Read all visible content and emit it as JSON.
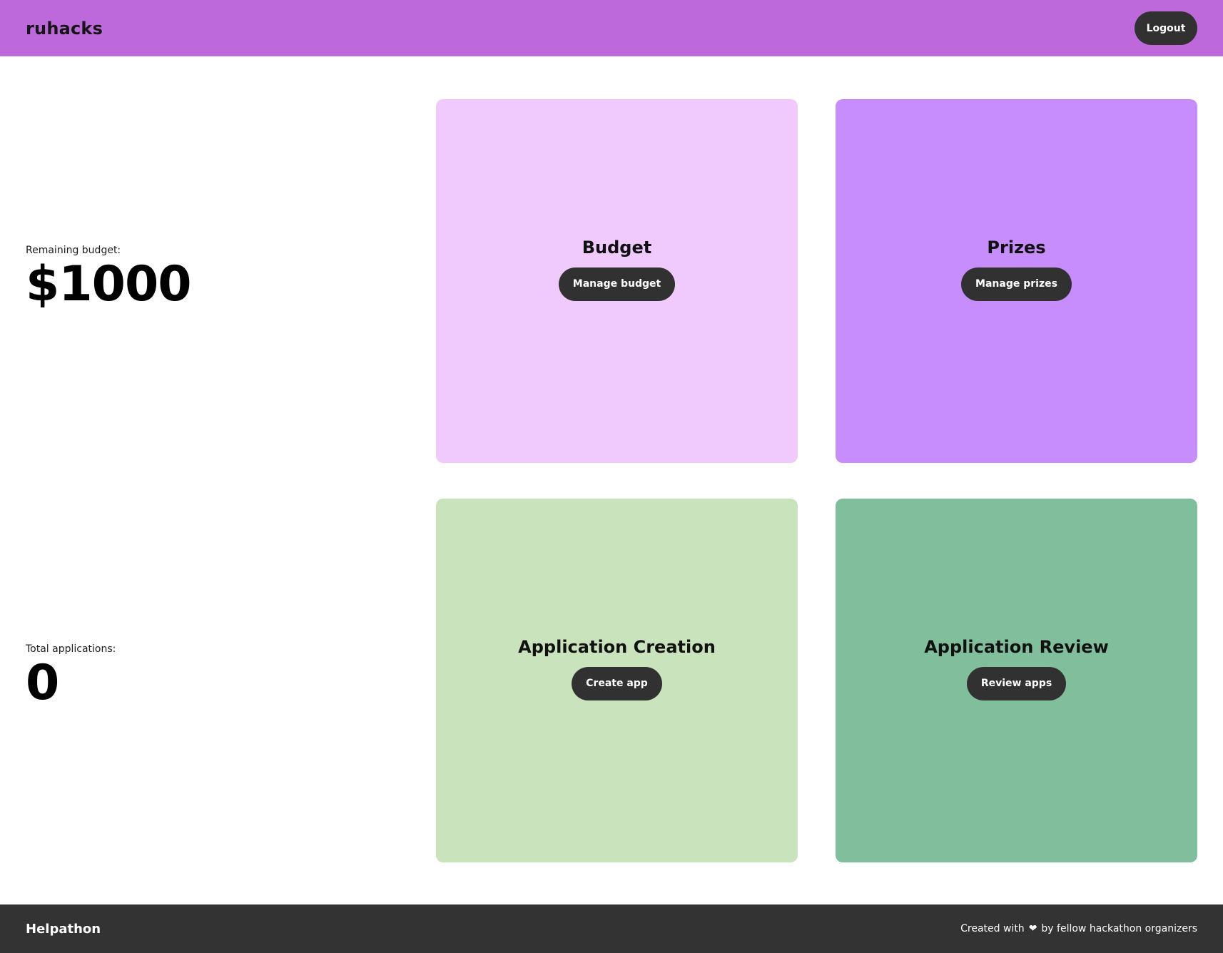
{
  "header": {
    "brand": "ruhacks",
    "logout_label": "Logout"
  },
  "stats": {
    "budget": {
      "label": "Remaining budget:",
      "value": "$1000"
    },
    "applications": {
      "label": "Total applications:",
      "value": "0"
    }
  },
  "cards": {
    "budget": {
      "title": "Budget",
      "button": "Manage budget"
    },
    "prizes": {
      "title": "Prizes",
      "button": "Manage prizes"
    },
    "create": {
      "title": "Application Creation",
      "button": "Create app"
    },
    "review": {
      "title": "Application Review",
      "button": "Review apps"
    }
  },
  "footer": {
    "brand": "Helpathon",
    "credit_before": "Created with",
    "heart_icon": "heart-icon",
    "credit_after": "by fellow hackathon organizers"
  },
  "colors": {
    "header_bg": "#bd69db",
    "budget_card": "#f0c9fd",
    "prizes_card": "#c78dfd",
    "create_card": "#c9e3bd",
    "review_card": "#81bf9c",
    "button_bg": "#313131",
    "footer_bg": "#333333"
  }
}
